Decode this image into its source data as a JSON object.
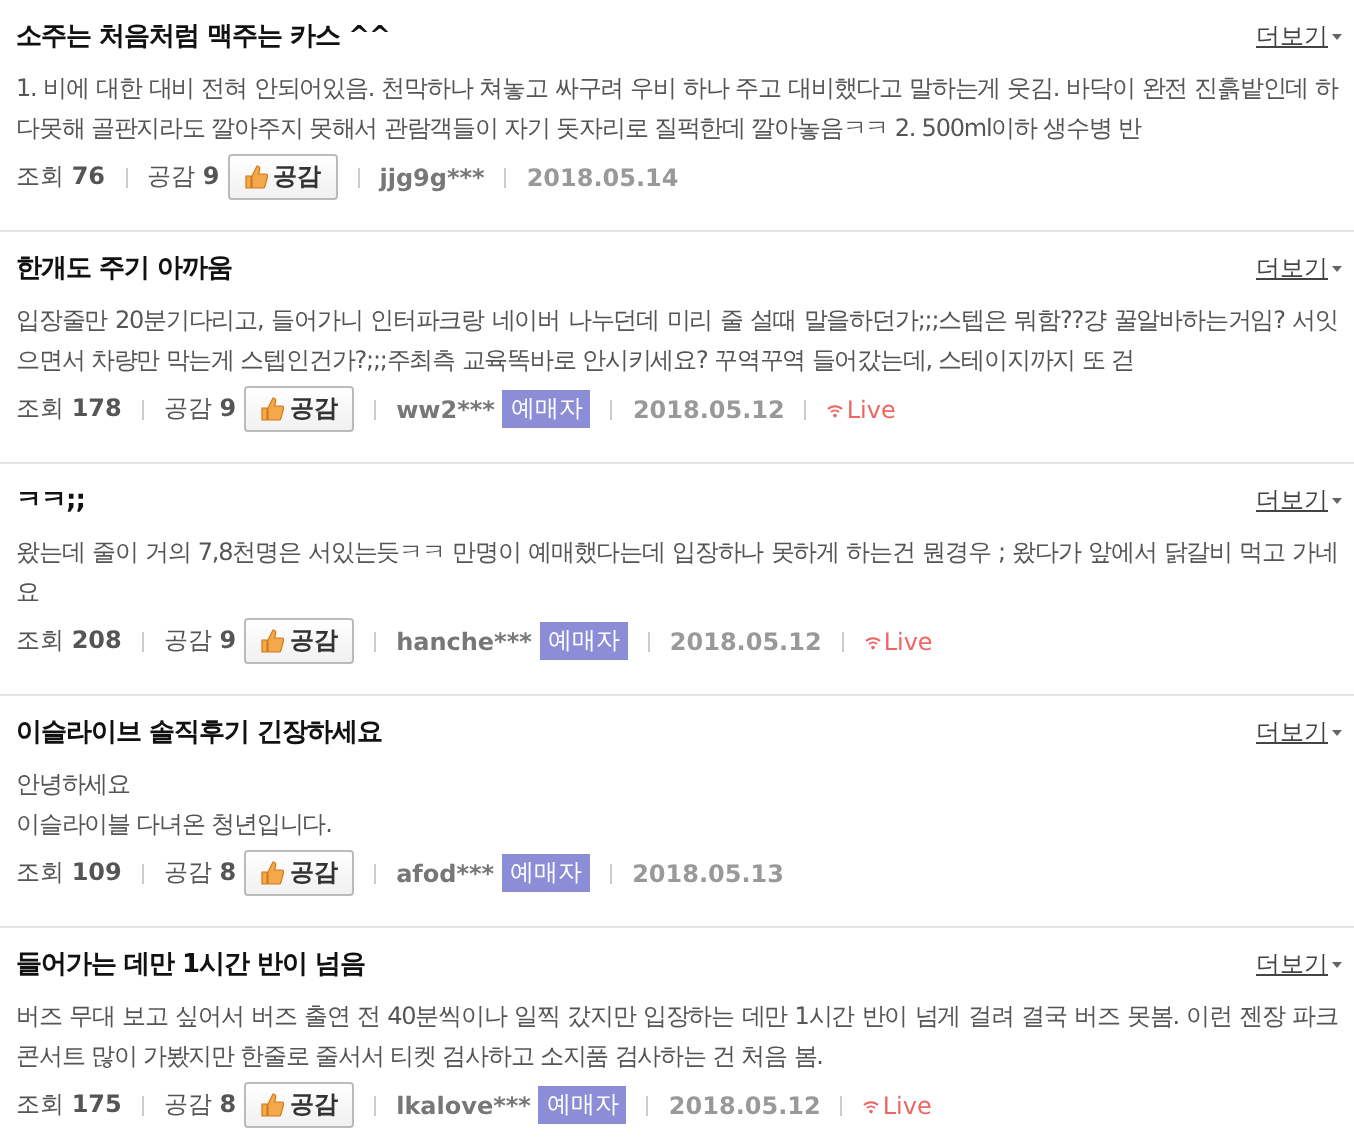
{
  "reviews": [
    {
      "title": "소주는 처음처럼 맥주는 카스 ^^",
      "more": "더보기",
      "body": [
        "1. 비에 대한 대비 전혀 안되어있음. 천막하나 쳐놓고 싸구려 우비 하나 주고 대비했다고 말하는게 웃김. 바닥이 완전 진흙밭인데 하다못해 골판지라도 깔아주지 못해서 관람객들이 자기 돗자리로 질퍽한데 깔아놓음ㅋㅋ 2. 500ml이하 생수병 반"
      ],
      "views_label": "조회",
      "views": "76",
      "likes_label": "공감",
      "likes": "9",
      "like_button": "공감",
      "author": "jjg9g***",
      "date": "2018.05.14"
    },
    {
      "title": "한개도 주기 아까움",
      "more": "더보기",
      "body": [
        "입장줄만 20분기다리고, 들어가니 인터파크랑 네이버 나누던데 미리 줄 설때 말을하던가;;;스텝은 뭐함??걍 꿀알바하는거임? 서잇으면서 차량만 막는게 스텝인건가?;;;주최측 교육똑바로 안시키세요? 꾸역꾸역 들어갔는데, 스테이지까지 또 걷"
      ],
      "views_label": "조회",
      "views": "178",
      "likes_label": "공감",
      "likes": "9",
      "like_button": "공감",
      "author": "ww2***",
      "badge": "예매자",
      "date": "2018.05.12",
      "live": "Live"
    },
    {
      "title": "ㅋㅋ;;",
      "more": "더보기",
      "body": [
        "왔는데 줄이 거의 7,8천명은 서있는듯ㅋㅋ 만명이 예매했다는데 입장하나 못하게 하는건 뭔경우 ; 왔다가 앞에서 닭갈비 먹고 가네요"
      ],
      "views_label": "조회",
      "views": "208",
      "likes_label": "공감",
      "likes": "9",
      "like_button": "공감",
      "author": "hanche***",
      "badge": "예매자",
      "date": "2018.05.12",
      "live": "Live"
    },
    {
      "title": "이슬라이브 솔직후기 긴장하세요",
      "more": "더보기",
      "body": [
        "안녕하세요",
        "이슬라이블 다녀온 청년입니다."
      ],
      "views_label": "조회",
      "views": "109",
      "likes_label": "공감",
      "likes": "8",
      "like_button": "공감",
      "author": "afod***",
      "badge": "예매자",
      "date": "2018.05.13"
    },
    {
      "title": "들어가는 데만 1시간 반이 넘음",
      "more": "더보기",
      "body": [
        "버즈 무대 보고 싶어서 버즈 출연 전 40분씩이나 일찍 갔지만 입장하는 데만 1시간 반이 넘게 걸려 결국 버즈 못봄. 이런 젠장 파크 콘서트 많이 가봤지만 한줄로 줄서서 티켓 검사하고 소지품 검사하는 건 처음 봄."
      ],
      "views_label": "조회",
      "views": "175",
      "likes_label": "공감",
      "likes": "8",
      "like_button": "공감",
      "author": "lkalove***",
      "badge": "예매자",
      "date": "2018.05.12",
      "live": "Live"
    }
  ]
}
